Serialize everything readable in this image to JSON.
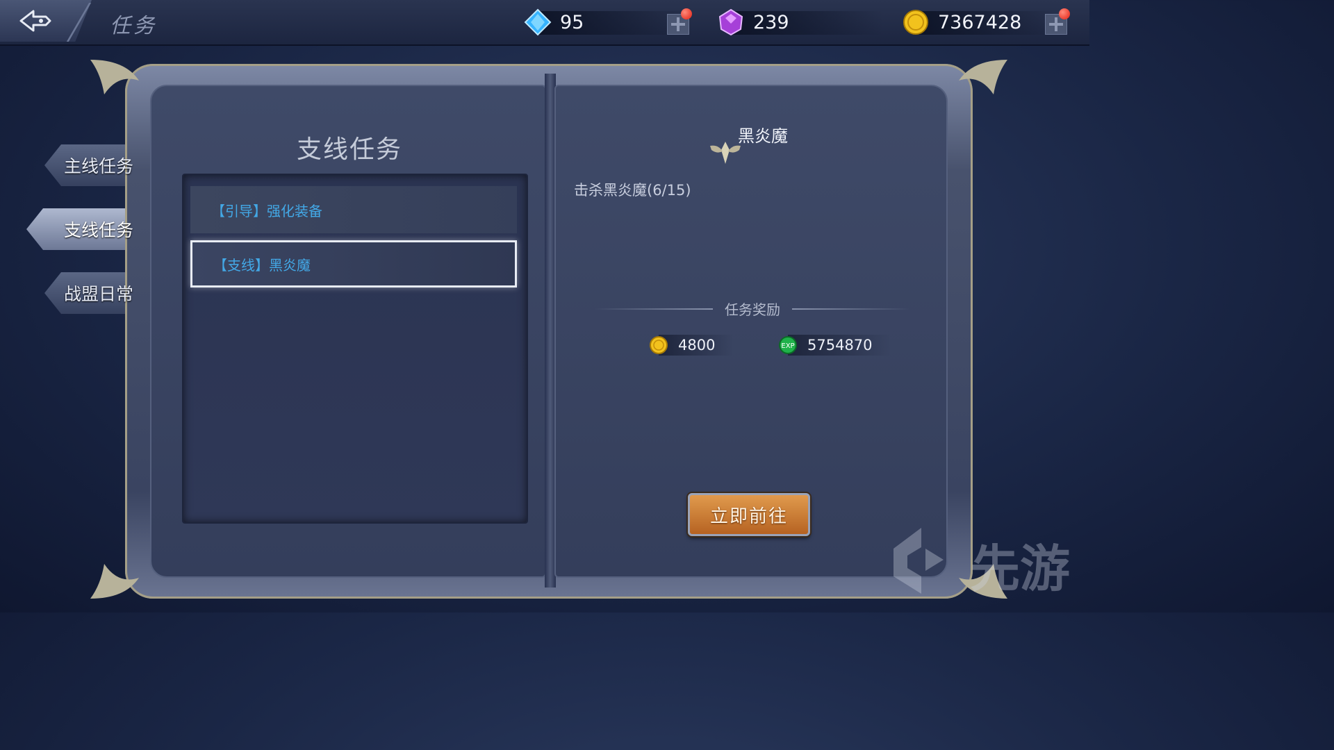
{
  "header": {
    "title": "任务",
    "currencies": [
      {
        "name": "diamond",
        "icon": "blue-diamond-icon",
        "value": "95"
      },
      {
        "name": "crystal",
        "icon": "purple-crystal-icon",
        "value": "239"
      },
      {
        "name": "gold",
        "icon": "gold-coin-icon",
        "value": "7367428"
      }
    ]
  },
  "sidebar": {
    "tabs": [
      {
        "label": "主线任务",
        "active": false
      },
      {
        "label": "支线任务",
        "active": true
      },
      {
        "label": "战盟日常",
        "active": false
      }
    ]
  },
  "left_page": {
    "section_title": "支线任务",
    "quests": [
      {
        "label": "【引导】强化装备",
        "selected": false
      },
      {
        "label": "【支线】黑炎魔",
        "selected": true
      }
    ]
  },
  "right_page": {
    "boss_name": "黑炎魔",
    "objective": "击杀黑炎魔(6/15)",
    "reward_title": "任务奖励",
    "rewards": [
      {
        "icon": "gold-coin-icon",
        "value": "4800"
      },
      {
        "icon": "exp-icon",
        "value": "5754870"
      }
    ],
    "go_button": "立即前往"
  },
  "watermark": {
    "text": "先游"
  },
  "colors": {
    "quest_text": "#43a8e6",
    "go_button": "#d0843a",
    "badge_red": "#e21f12"
  }
}
